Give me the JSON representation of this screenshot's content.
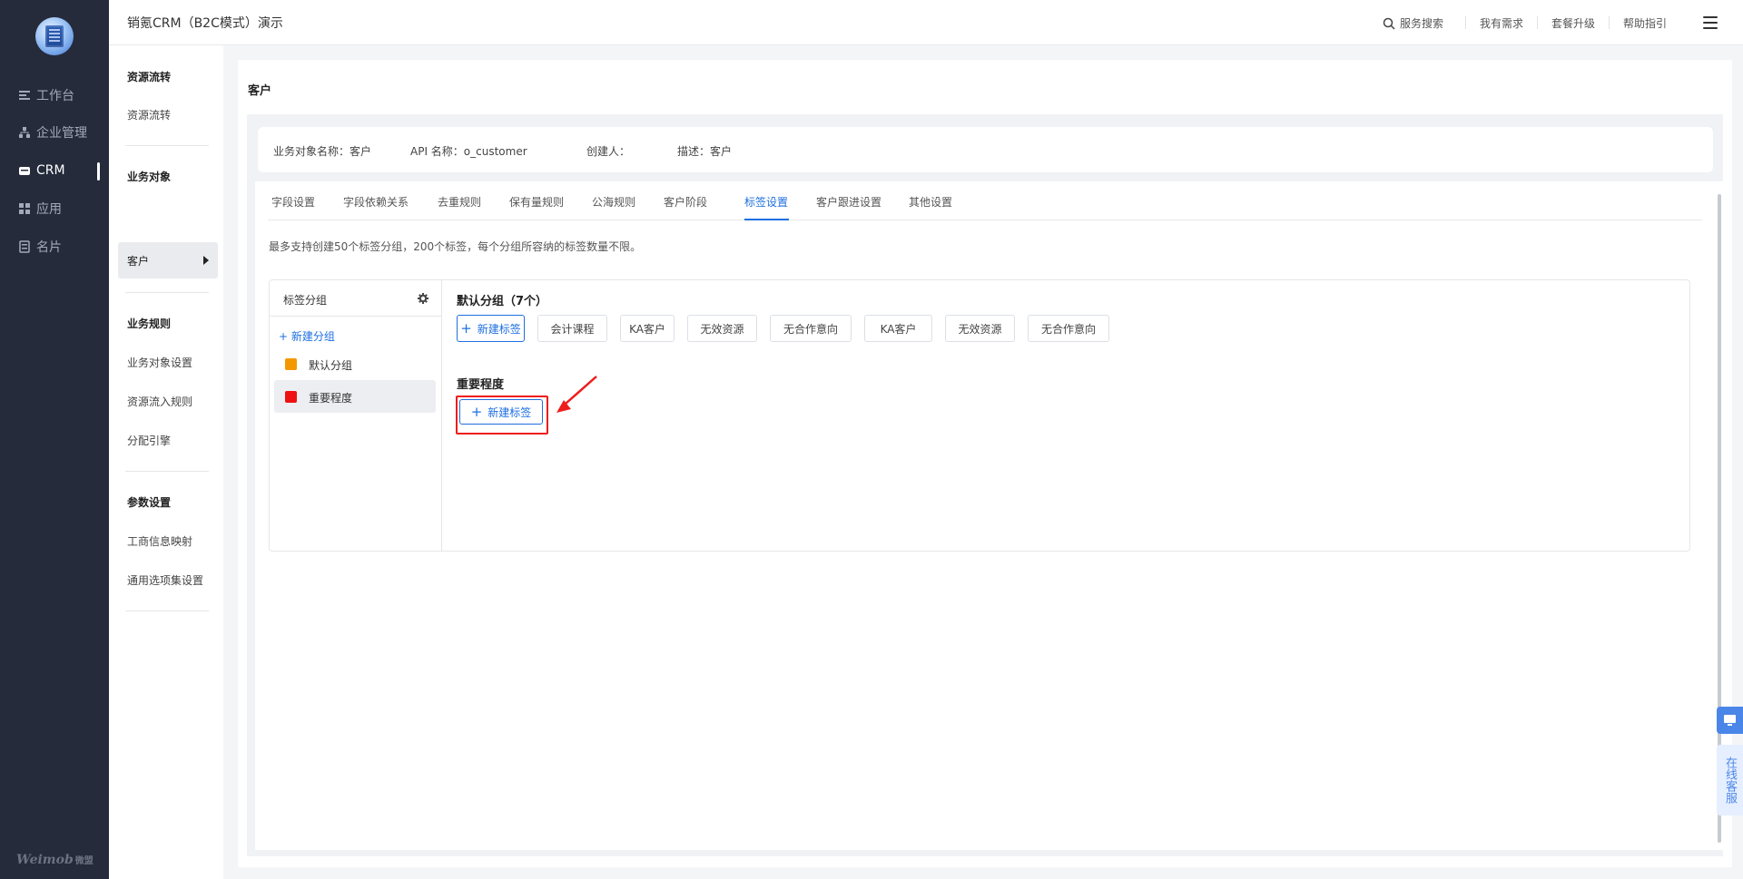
{
  "app": {
    "title": "销氪CRM（B2C模式）演示"
  },
  "leftnav": {
    "items": [
      {
        "label": "工作台",
        "icon": "workbench-icon"
      },
      {
        "label": "企业管理",
        "icon": "org-icon"
      },
      {
        "label": "CRM",
        "icon": "crm-icon",
        "active": true
      },
      {
        "label": "应用",
        "icon": "apps-icon"
      },
      {
        "label": "名片",
        "icon": "card-icon"
      }
    ],
    "brand": "Weimob",
    "brand_cn": "微盟"
  },
  "header": {
    "search_label": "服务搜索",
    "demand_label": "我有需求",
    "upgrade_label": "套餐升级",
    "help_label": "帮助指引"
  },
  "subnav": {
    "sections": [
      {
        "title": "资源流转",
        "items": [
          "资源流转"
        ]
      },
      {
        "title": "业务对象",
        "items": [
          "客户"
        ]
      },
      {
        "title": "业务规则",
        "items": [
          "业务对象设置",
          "资源流入规则",
          "分配引擎"
        ]
      },
      {
        "title": "参数设置",
        "items": [
          "工商信息映射",
          "通用选项集设置"
        ]
      }
    ]
  },
  "page": {
    "title": "客户",
    "info": {
      "object_name": "业务对象名称：客户",
      "api_name": "API 名称：o_customer",
      "creator": "创建人：",
      "description": "描述：客户"
    },
    "tabs": [
      "字段设置",
      "字段依赖关系",
      "去重规则",
      "保有量规则",
      "公海规则",
      "客户阶段",
      "标签设置",
      "客户跟进设置",
      "其他设置"
    ],
    "active_tab": "标签设置",
    "note": "最多支持创建50个标签分组，200个标签，每个分组所容纳的标签数量不限。",
    "tag_groups": {
      "header": "标签分组",
      "new_group": "+ 新建分组",
      "groups": [
        {
          "name": "默认分组",
          "color": "#f39800"
        },
        {
          "name": "重要程度",
          "color": "#ee1111",
          "selected": true
        }
      ]
    },
    "groups_detail": [
      {
        "title": "默认分组（7个）",
        "new_tag": "新建标签",
        "tags": [
          "会计课程",
          "KA客户",
          "无效资源",
          "无合作意向",
          "KA客户",
          "无效资源",
          "无合作意向"
        ]
      },
      {
        "title": "重要程度",
        "new_tag": "新建标签",
        "tags": []
      }
    ]
  },
  "float_widget": {
    "label": "在线客服"
  }
}
